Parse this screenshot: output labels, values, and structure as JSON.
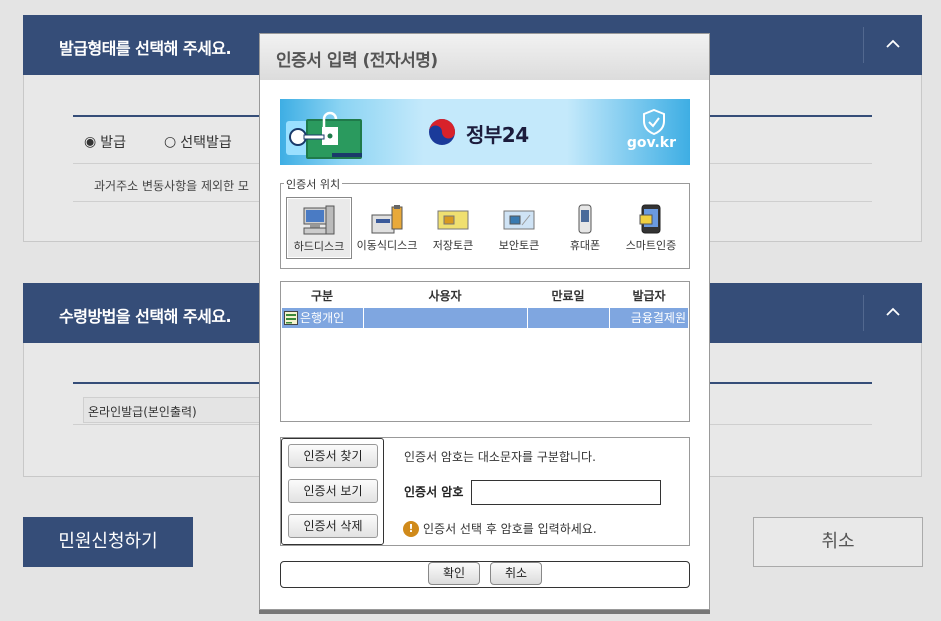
{
  "background": {
    "section1": {
      "title": "발급형태를 선택해 주세요.",
      "radio_issue": "발급",
      "radio_select_issue": "선택발급",
      "note": "과거주소 변동사항을 제외한 모"
    },
    "section2": {
      "title": "수령방법을 선택해 주세요.",
      "option": "온라인발급(본인출력)"
    },
    "apply_button": "민원신청하기",
    "cancel_button": "취소"
  },
  "dialog": {
    "title": "인증서 입력 (전자서명)",
    "banner": {
      "brand": "정부24",
      "domain": "gov.kr"
    },
    "location": {
      "legend": "인증서 위치",
      "items": [
        {
          "label": "하드디스크",
          "icon": "hard-disk-icon",
          "selected": true
        },
        {
          "label": "이동식디스크",
          "icon": "removable-disk-icon",
          "selected": false
        },
        {
          "label": "저장토큰",
          "icon": "storage-token-icon",
          "selected": false
        },
        {
          "label": "보안토큰",
          "icon": "security-token-icon",
          "selected": false
        },
        {
          "label": "휴대폰",
          "icon": "mobile-phone-icon",
          "selected": false
        },
        {
          "label": "스마트인증",
          "icon": "smart-auth-icon",
          "selected": false
        }
      ]
    },
    "table": {
      "headers": [
        "구분",
        "사용자",
        "만료일",
        "발급자"
      ],
      "rows": [
        {
          "type": "은행개인",
          "user": "",
          "expiry": "",
          "issuer": "금융결제원"
        }
      ]
    },
    "buttons": {
      "find": "인증서 찾기",
      "view": "인증서 보기",
      "delete": "인증서 삭제",
      "ok": "확인",
      "cancel": "취소"
    },
    "password": {
      "case_note": "인증서 암호는 대소문자를 구분합니다.",
      "label": "인증서 암호",
      "value": "",
      "warning": "인증서 선택 후 암호를 입력하세요."
    }
  },
  "colors": {
    "navy": "#354d78",
    "selected_row": "#7fa6e0",
    "banner": "#3eaee4"
  }
}
